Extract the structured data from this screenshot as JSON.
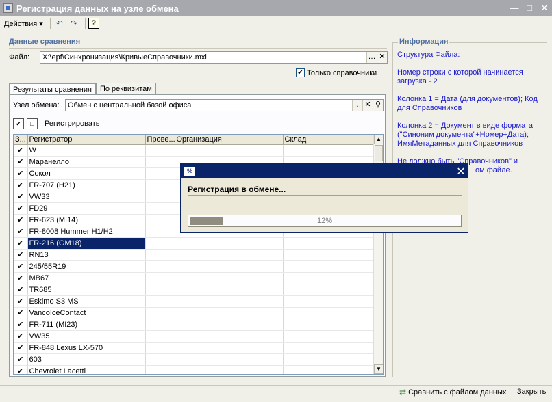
{
  "window": {
    "title": "Регистрация данных на узле обмена",
    "min_icon": "minimize-icon",
    "max_icon": "maximize-icon",
    "close_icon": "close-icon"
  },
  "toolbar": {
    "actions_label": "Действия ▾",
    "help_label": "?"
  },
  "comparison": {
    "group_title": "Данные сравнения",
    "file_label": "Файл:",
    "file_value": "X:\\epf\\Синхронизация\\КривыеСправочники.mxl",
    "only_refs_label": "Только справочники"
  },
  "tabs": [
    {
      "label": "Результаты сравнения"
    },
    {
      "label": "По реквизитам"
    }
  ],
  "node": {
    "label": "Узел обмена:",
    "value": "Обмен с центральной базой офиса"
  },
  "subtoolbar": {
    "register_label": "Регистрировать"
  },
  "grid": {
    "columns": [
      "З...",
      "Регистратор",
      "Прове...",
      "Организация",
      "Склад"
    ],
    "rows": [
      "W",
      "Маранелло",
      "Сокол",
      "FR-707  (H21)",
      "VW33",
      "FD29",
      "FR-623  (MI14)",
      "FR-8008   Hummer H1/H2",
      "FR-216  (GM18)",
      "RN13",
      "245/55R19",
      "MB67",
      "TR685",
      "Eskimo S3 MS",
      "VancoIceContact",
      "FR-711  (MI23)",
      "VW35",
      "FR-848  Lexus  LX-570",
      "603",
      "Chevrolet Lacetti"
    ],
    "selected_index": 8
  },
  "info": {
    "title": "Информация",
    "p1": "Структура Файла:",
    "p2": "Номер строки с которой начинается загрузка - 2",
    "p3": "Колонка 1 = Дата (для документов); Код для Справочников",
    "p4": "Колонка 2 = Документ в виде формата (\"Синоним документа\"+Номер+Дата); ИмяМетаданных для Справочников",
    "p5": "Не должно быть \"Справочников\" и",
    "p6": "ом файле."
  },
  "dialog": {
    "title_icon": "%",
    "message": "Регистрация в обмене...",
    "progress": 12,
    "progress_text": "12%"
  },
  "bottom": {
    "compare_label": "Сравнить с файлом данных",
    "close_label": "Закрыть"
  }
}
